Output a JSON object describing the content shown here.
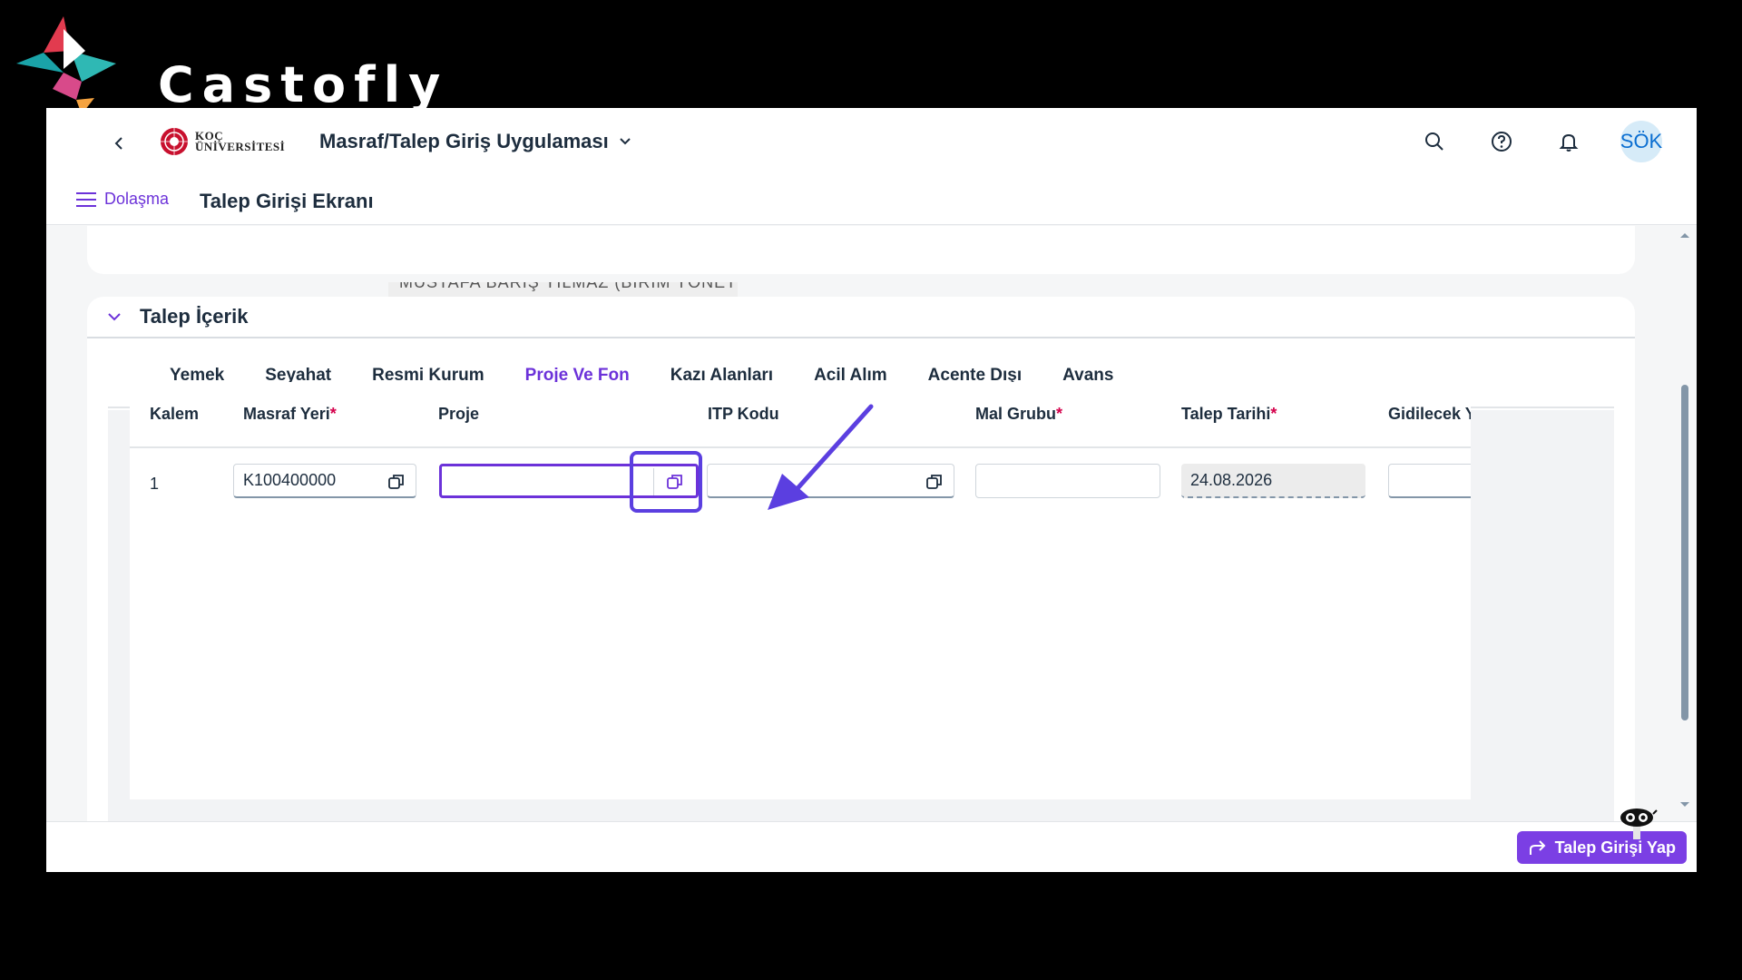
{
  "branding": {
    "name": "Castofly"
  },
  "shell": {
    "back_icon": "chevron-left-icon",
    "logo_text_line1": "KOÇ",
    "logo_text_line2": "ÜNİVERSİTESİ",
    "app_title": "Masraf/Talep Giriş Uygulaması",
    "avatar_initials": "SÖK"
  },
  "subheader": {
    "nav_label": "Dolaşma",
    "page_title": "Talep Girişi Ekranı"
  },
  "top_card": {
    "partial_value": "MUSTAFA BARIŞ YILMAZ (BİRİM YÖNETİCİSİ)"
  },
  "section": {
    "title": "Talep İçerik",
    "tabs": [
      {
        "label": "Yemek"
      },
      {
        "label": "Seyahat"
      },
      {
        "label": "Resmi Kurum"
      },
      {
        "label": "Proje Ve Fon",
        "active": true
      },
      {
        "label": "Kazı Alanları"
      },
      {
        "label": "Acil Alım"
      },
      {
        "label": "Acente Dışı"
      },
      {
        "label": "Avans"
      }
    ]
  },
  "table": {
    "headers": {
      "kalem": "Kalem",
      "masraf_yeri": "Masraf Yeri",
      "proje": "Proje",
      "itp_kodu": "ITP Kodu",
      "mal_grubu": "Mal Grubu",
      "talep_tarihi": "Talep Tarihi",
      "gidilecek": "Gidilecek Y"
    },
    "required_mark": "*",
    "row": {
      "kalem": "1",
      "masraf_yeri": "K100400000",
      "proje": "",
      "itp_kodu": "",
      "mal_grubu": "",
      "talep_tarihi": "24.08.2026",
      "gidilecek": ""
    }
  },
  "footer": {
    "submit_label": "Talep Girişi Yap"
  },
  "colors": {
    "accent": "#6c32d9",
    "highlight": "#5b3fe0",
    "required": "#d4004b"
  }
}
